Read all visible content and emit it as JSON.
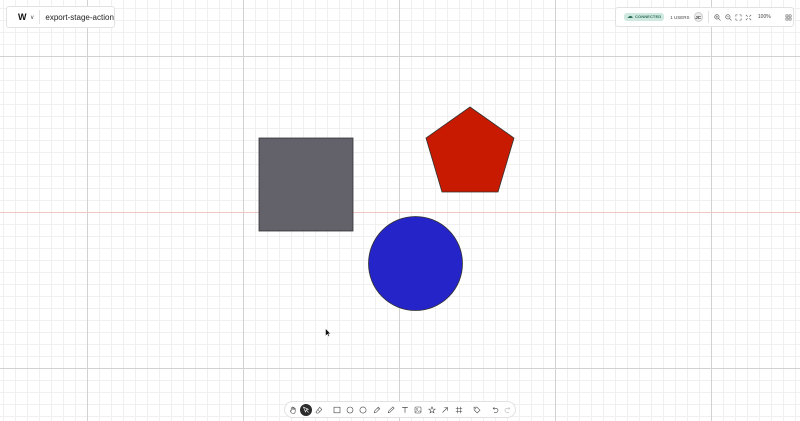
{
  "header": {
    "logo": "W",
    "title": "export-stage-action"
  },
  "status": {
    "connection": "CONNECTED",
    "users": "1 USERS",
    "avatar": "JC",
    "zoom": "100%"
  },
  "canvas": {
    "shapes": [
      {
        "kind": "rectangle",
        "fill": "#63626b"
      },
      {
        "kind": "pentagon",
        "fill": "#c71a00"
      },
      {
        "kind": "circle",
        "fill": "#2424c8"
      }
    ],
    "stroke_color": "#333333"
  },
  "toolbar": {
    "tools": [
      {
        "name": "hand-icon",
        "active": false
      },
      {
        "name": "select-icon",
        "active": true
      },
      {
        "name": "eraser-icon",
        "active": false
      },
      {
        "name": "rectangle-icon",
        "active": false
      },
      {
        "name": "ellipse-icon",
        "active": false
      },
      {
        "name": "circle-icon",
        "active": false
      },
      {
        "name": "pen-icon",
        "active": false
      },
      {
        "name": "pencil-icon",
        "active": false
      },
      {
        "name": "text-icon",
        "active": false
      },
      {
        "name": "image-icon",
        "active": false
      },
      {
        "name": "star-icon",
        "active": false
      },
      {
        "name": "arrow-icon",
        "active": false
      },
      {
        "name": "frame-icon",
        "active": false
      },
      {
        "name": "tag-icon",
        "active": false
      },
      {
        "name": "undo-icon",
        "active": false
      },
      {
        "name": "redo-icon",
        "active": false
      }
    ]
  },
  "colors": {
    "accent": "#2b2b2b",
    "connected_bg": "#cfe9e0",
    "connected_text": "#2f6e59"
  }
}
